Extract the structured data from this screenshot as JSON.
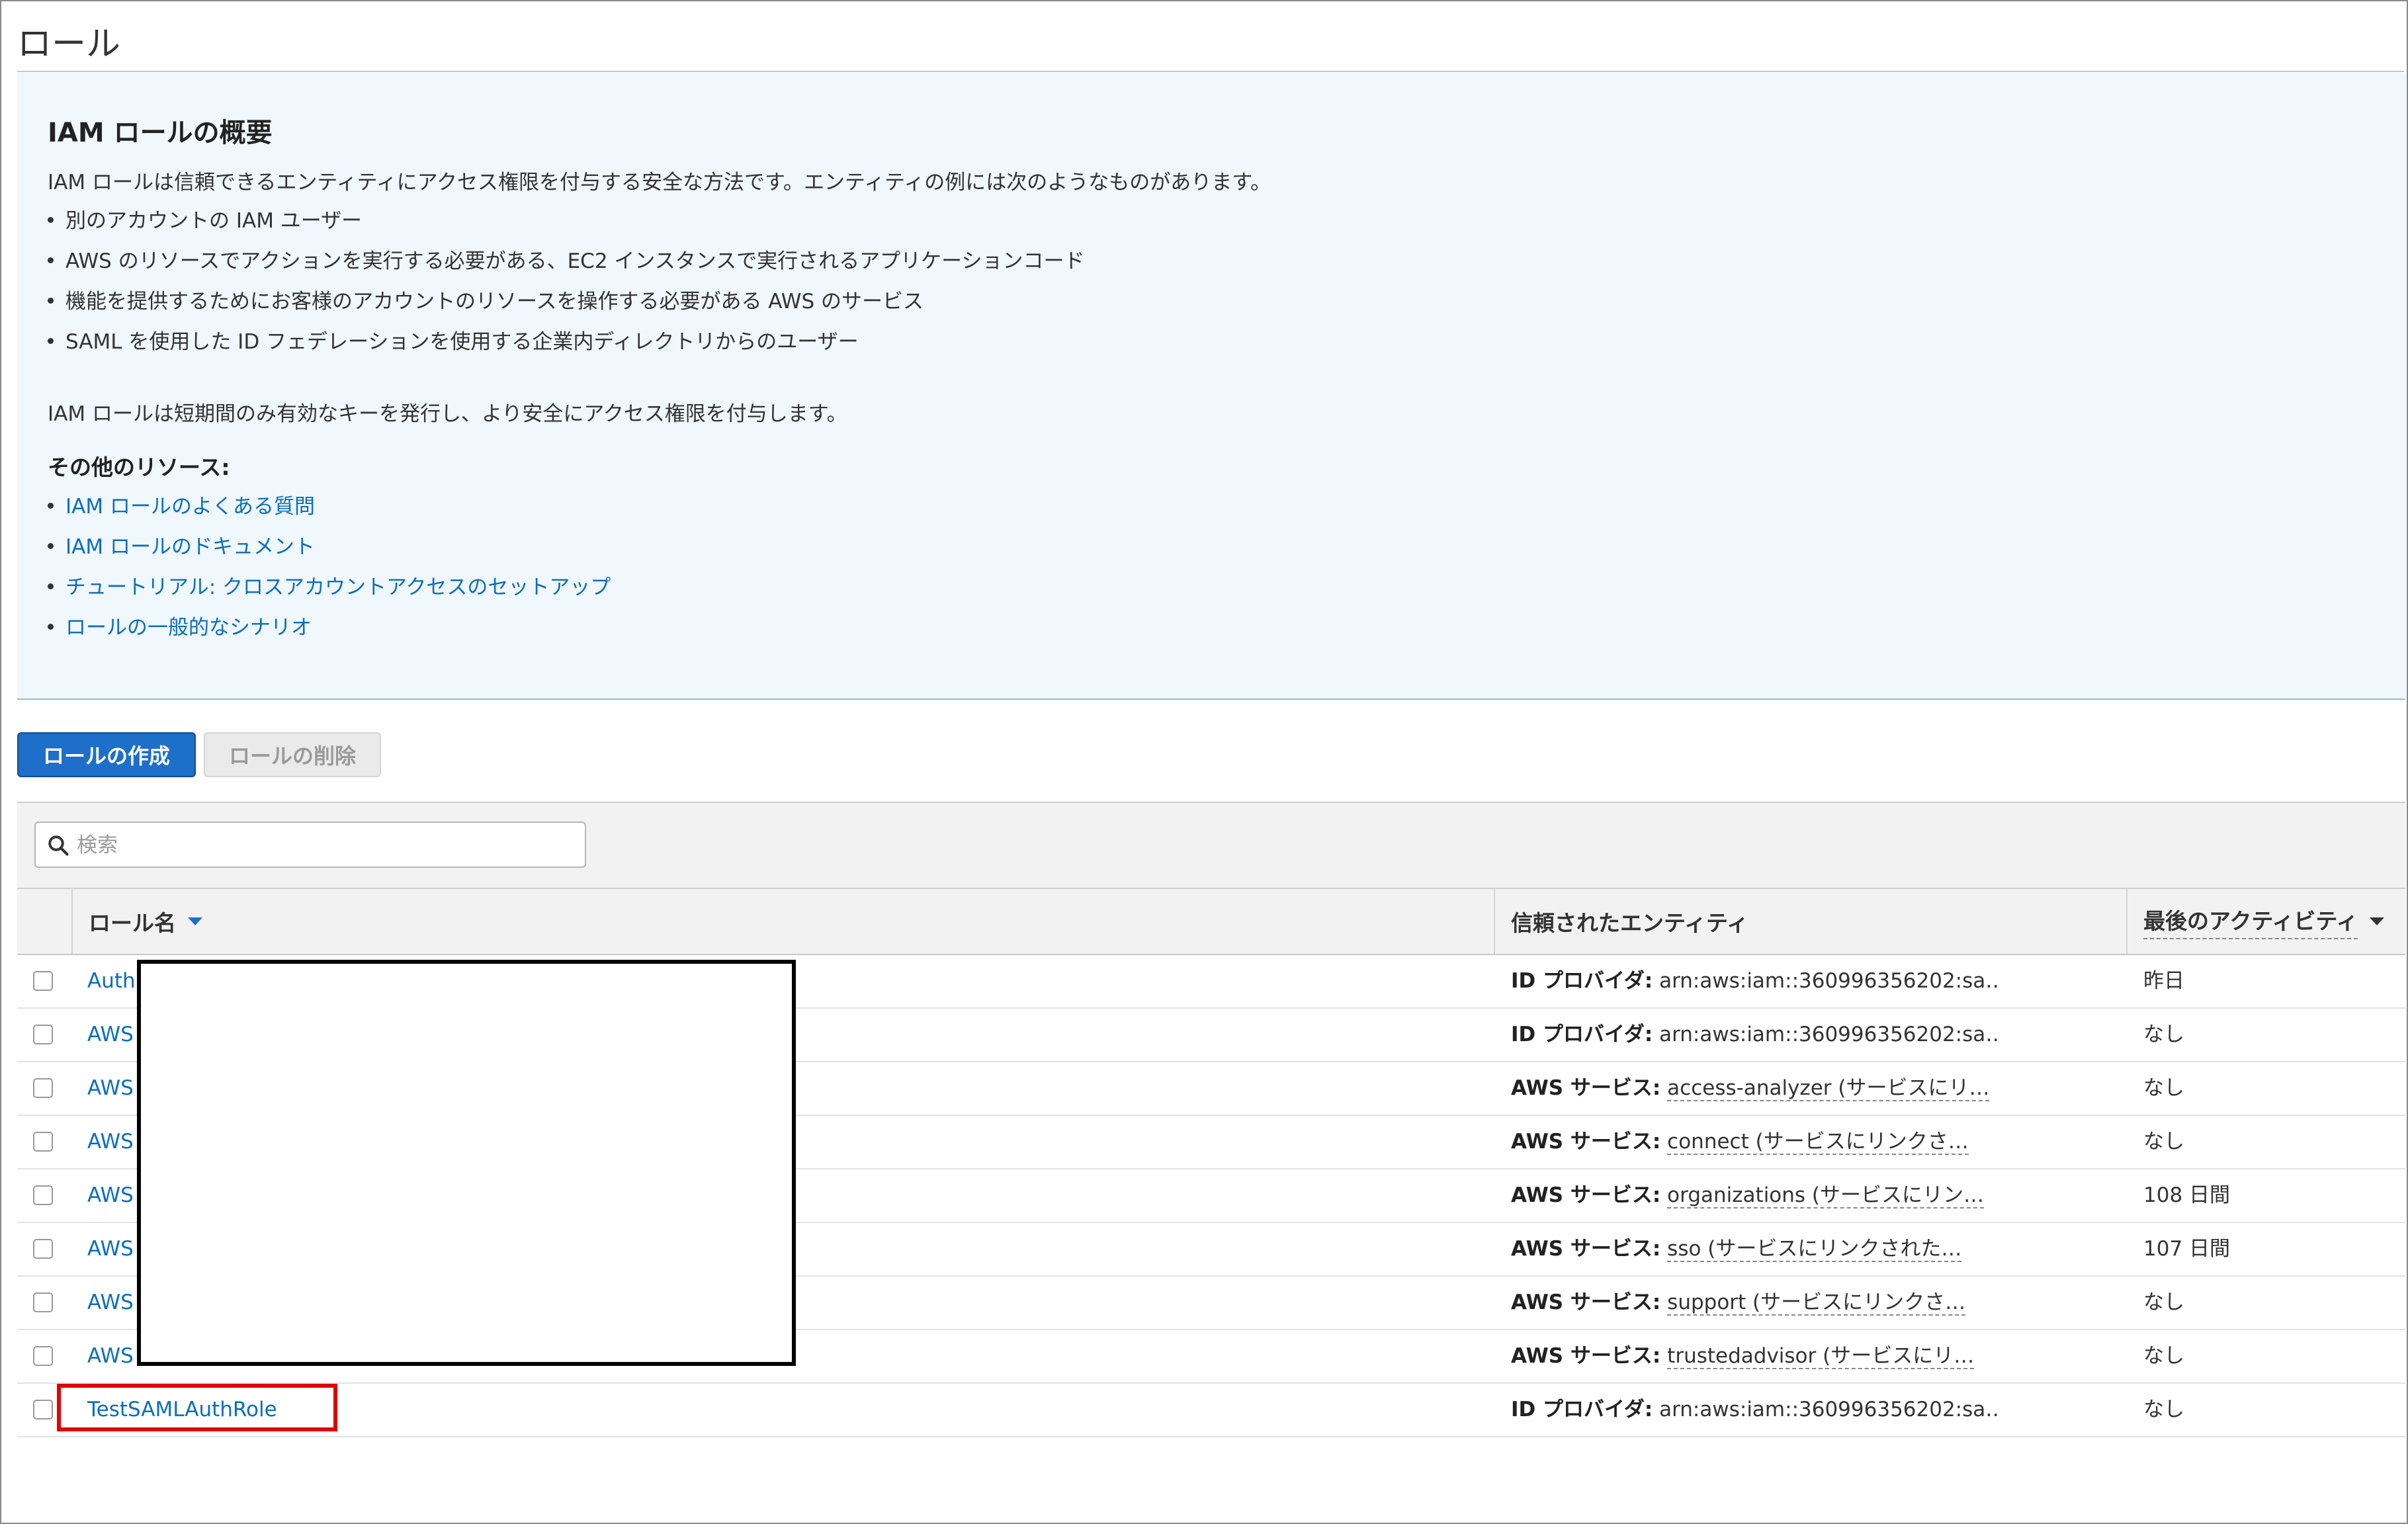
{
  "page": {
    "title": "ロール"
  },
  "info": {
    "heading": "IAM ロールの概要",
    "intro": "IAM ロールは信頼できるエンティティにアクセス権限を付与する安全な方法です。エンティティの例には次のようなものがあります。",
    "bullets": [
      "別のアカウントの IAM ユーザー",
      "AWS のリソースでアクションを実行する必要がある、EC2 インスタンスで実行されるアプリケーションコード",
      "機能を提供するためにお客様のアカウントのリソースを操作する必要がある AWS のサービス",
      "SAML を使用した ID フェデレーションを使用する企業内ディレクトリからのユーザー"
    ],
    "summary": "IAM ロールは短期間のみ有効なキーを発行し、より安全にアクセス権限を付与します。",
    "resources_heading": "その他のリソース:",
    "resource_links": [
      "IAM ロールのよくある質問",
      "IAM ロールのドキュメント",
      "チュートリアル: クロスアカウントアクセスのセットアップ",
      "ロールの一般的なシナリオ"
    ]
  },
  "toolbar": {
    "create_label": "ロールの作成",
    "delete_label": "ロールの削除"
  },
  "search": {
    "placeholder": "検索",
    "icon": "search-icon"
  },
  "table": {
    "columns": {
      "name": "ロール名",
      "entity": "信頼されたエンティティ",
      "activity": "最後のアクティビティ"
    },
    "rows": [
      {
        "name": "Auth",
        "entity_type": "ID プロバイダ:",
        "entity_detail": "arn:aws:iam::360996356202:sa…",
        "activity": "昨日"
      },
      {
        "name": "AWS",
        "entity_type": "ID プロバイダ:",
        "entity_detail": "arn:aws:iam::360996356202:sa…",
        "activity": "なし"
      },
      {
        "name": "AWS",
        "entity_type": "AWS サービス:",
        "entity_detail": "access-analyzer (サービスにリ…",
        "activity": "なし"
      },
      {
        "name": "AWS",
        "entity_type": "AWS サービス:",
        "entity_detail": "connect (サービスにリンクさ…",
        "activity": "なし"
      },
      {
        "name": "AWS",
        "entity_type": "AWS サービス:",
        "entity_detail": "organizations (サービスにリン…",
        "activity": "108 日間"
      },
      {
        "name": "AWS",
        "entity_type": "AWS サービス:",
        "entity_detail": "sso (サービスにリンクされた…",
        "activity": "107 日間"
      },
      {
        "name": "AWS",
        "entity_type": "AWS サービス:",
        "entity_detail": "support (サービスにリンクさ…",
        "activity": "なし"
      },
      {
        "name": "AWS",
        "entity_type": "AWS サービス:",
        "entity_detail": "trustedadvisor (サービスにリ…",
        "activity": "なし"
      },
      {
        "name": "TestSAMLAuthRole",
        "entity_type": "ID プロバイダ:",
        "entity_detail": "arn:aws:iam::360996356202:sa…",
        "activity": "なし"
      }
    ]
  },
  "colors": {
    "primary": "#1d6fc9",
    "link": "#0a6ebd",
    "info_bg": "#f0f7fd",
    "highlight": "#e00000"
  }
}
